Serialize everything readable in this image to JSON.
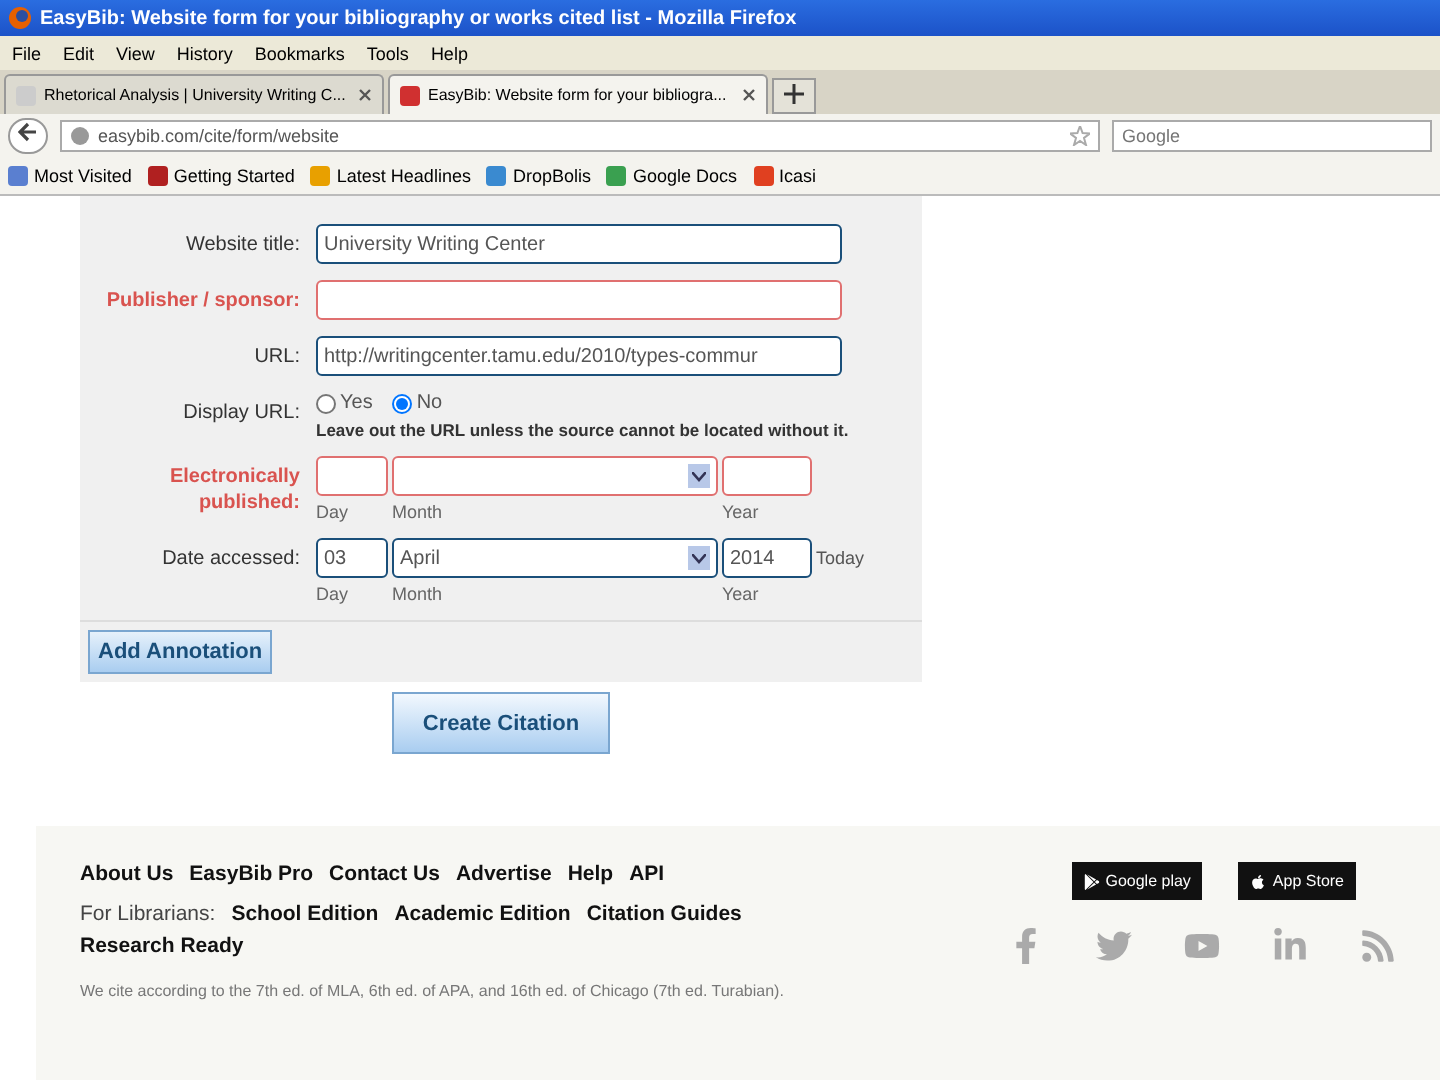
{
  "window": {
    "title": "EasyBib: Website form for your bibliography or works cited list - Mozilla Firefox"
  },
  "menu": [
    "File",
    "Edit",
    "View",
    "History",
    "Bookmarks",
    "Tools",
    "Help"
  ],
  "tabs": [
    {
      "label": "Rhetorical Analysis | University Writing C...",
      "selected": false
    },
    {
      "label": "EasyBib: Website form for your bibliogra...",
      "selected": true
    }
  ],
  "address_bar": {
    "value": "easybib.com/cite/form/website"
  },
  "search": {
    "placeholder": "Google"
  },
  "bookmarks": [
    "Most Visited",
    "Getting Started",
    "Latest Headlines",
    "DropBolis",
    "Google Docs",
    "Icasi"
  ],
  "form": {
    "fields": [
      {
        "kind": "text",
        "label": "Website title:",
        "required": false,
        "value": "University Writing Center"
      },
      {
        "kind": "text",
        "label": "Publisher / sponsor:",
        "required": true
      },
      {
        "kind": "text",
        "label": "URL:",
        "required": false,
        "value": "http://writingcenter.tamu.edu/2010/types-commur"
      },
      {
        "kind": "radio",
        "label": "Display URL:",
        "options": [
          {
            "label": "Yes",
            "selected": false
          },
          {
            "label": "No",
            "selected": true
          }
        ],
        "note": "Leave out the URL unless the source cannot be located without it."
      },
      {
        "kind": "date",
        "label": "Electronically published:",
        "required": true,
        "sublabels": [
          "Day",
          "Month",
          "Year"
        ]
      },
      {
        "kind": "date",
        "label": "Date accessed:",
        "required": false,
        "day": "03",
        "month": "April",
        "year": "2014",
        "today": "Today",
        "sublabels": [
          "Day",
          "Month",
          "Year"
        ]
      }
    ],
    "add_annotation": "Add Annotation",
    "create_citation": "Create Citation"
  },
  "footer": {
    "links": [
      "About Us",
      "EasyBib Pro",
      "Contact Us",
      "Advertise",
      "Help",
      "API"
    ],
    "librarians_label": "For Librarians:",
    "librarian_links": [
      "School Edition",
      "Academic Edition",
      "Citation Guides",
      "Research Ready"
    ],
    "note": "We cite according to the 7th ed. of MLA, 6th ed. of APA, and 16th ed. of Chicago (7th ed. Turabian).",
    "badges": [
      "Google play",
      "App Store"
    ]
  }
}
